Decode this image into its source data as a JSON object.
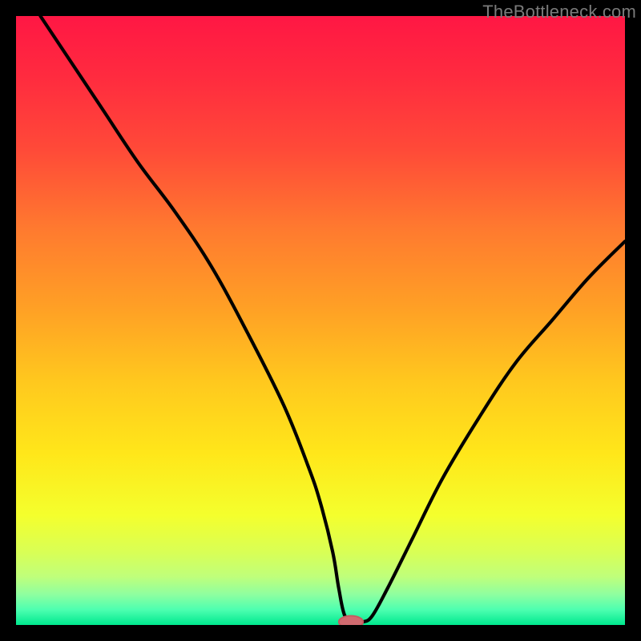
{
  "watermark": "TheBottleneck.com",
  "colors": {
    "frame": "#000000",
    "gradient_stops": [
      {
        "offset": 0.0,
        "color": "#ff1744"
      },
      {
        "offset": 0.1,
        "color": "#ff2b3f"
      },
      {
        "offset": 0.22,
        "color": "#ff4a38"
      },
      {
        "offset": 0.35,
        "color": "#ff7a2f"
      },
      {
        "offset": 0.48,
        "color": "#ffa025"
      },
      {
        "offset": 0.6,
        "color": "#ffc81e"
      },
      {
        "offset": 0.72,
        "color": "#ffe71a"
      },
      {
        "offset": 0.82,
        "color": "#f4ff2d"
      },
      {
        "offset": 0.88,
        "color": "#d9ff55"
      },
      {
        "offset": 0.92,
        "color": "#c0ff7a"
      },
      {
        "offset": 0.95,
        "color": "#8effa0"
      },
      {
        "offset": 0.975,
        "color": "#4dffb0"
      },
      {
        "offset": 1.0,
        "color": "#00e88e"
      }
    ],
    "curve": "#000000",
    "marker_fill": "#d06a6f",
    "marker_stroke": "#c65a60"
  },
  "chart_data": {
    "type": "line",
    "title": "",
    "xlabel": "",
    "ylabel": "",
    "xlim": [
      0,
      100
    ],
    "ylim": [
      0,
      100
    ],
    "grid": false,
    "series": [
      {
        "name": "bottleneck-curve",
        "x": [
          4,
          8,
          14,
          20,
          26,
          32,
          38,
          44,
          48,
          50,
          52,
          53,
          54,
          55.5,
          57,
          58.5,
          61,
          65,
          70,
          76,
          82,
          88,
          94,
          100
        ],
        "values": [
          100,
          94,
          85,
          76,
          68,
          59,
          48,
          36,
          26,
          20,
          12,
          6,
          1.5,
          0.5,
          0.5,
          1.5,
          6,
          14,
          24,
          34,
          43,
          50,
          57,
          63
        ]
      }
    ],
    "marker": {
      "x": 55,
      "y": 0.5,
      "rx": 2.0,
      "ry": 1.0
    },
    "annotations": []
  }
}
